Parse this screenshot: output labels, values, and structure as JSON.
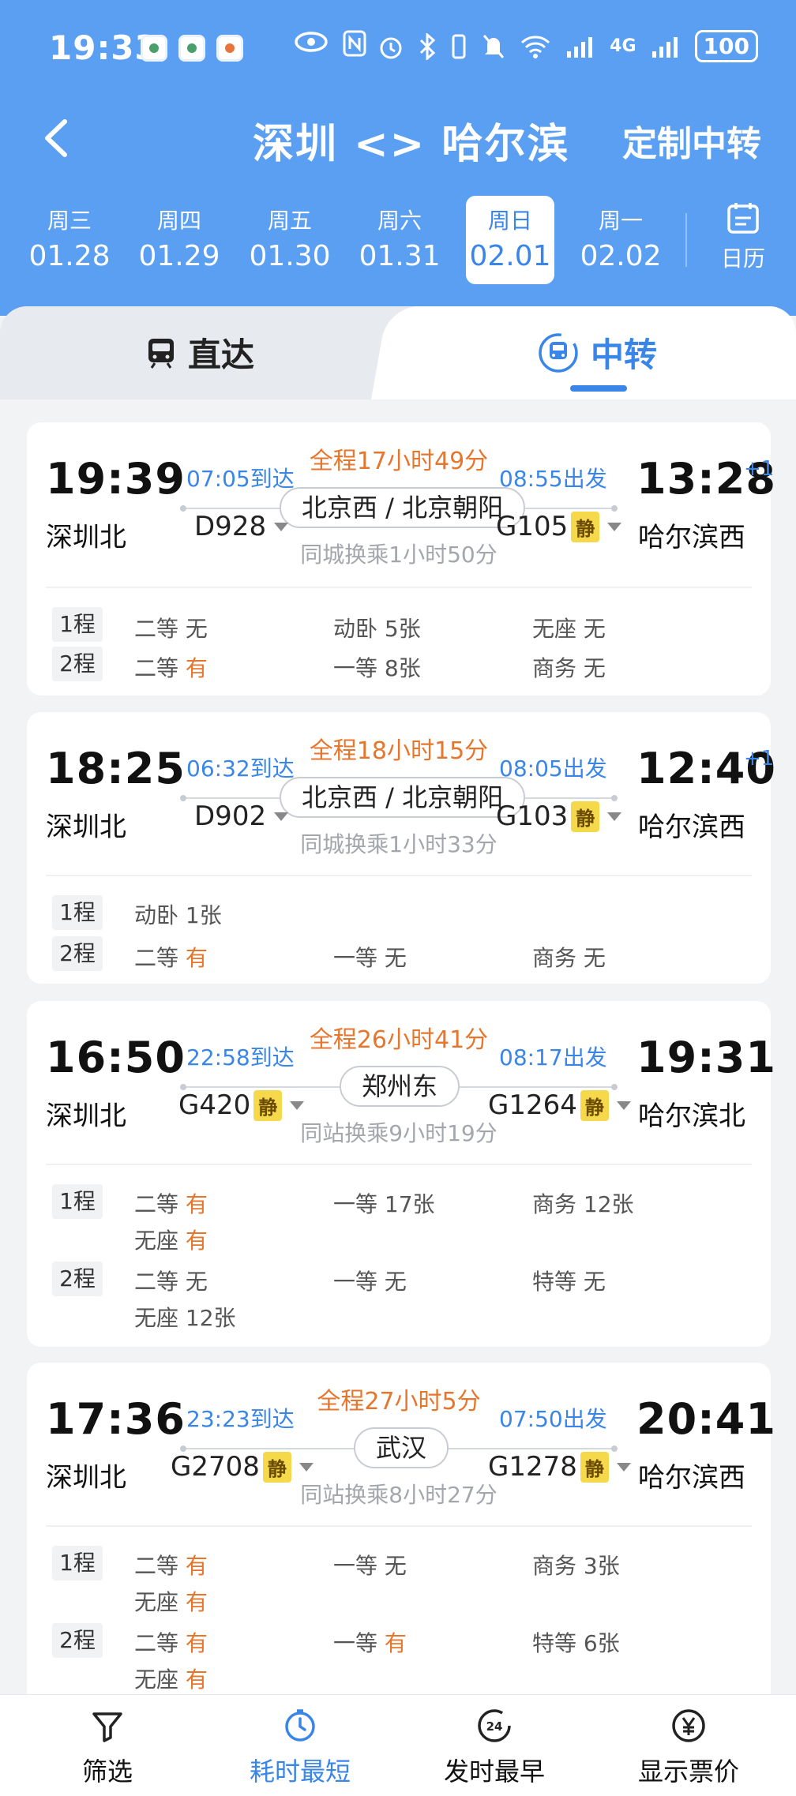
{
  "status_bar": {
    "time": "19:33",
    "battery": "100",
    "network": "4G"
  },
  "nav": {
    "title": "深圳 <> 哈尔滨",
    "action": "定制中转"
  },
  "dates": [
    {
      "dow": "周三",
      "date": "01.28"
    },
    {
      "dow": "周四",
      "date": "01.29"
    },
    {
      "dow": "周五",
      "date": "01.30"
    },
    {
      "dow": "周六",
      "date": "01.31"
    },
    {
      "dow": "周日",
      "date": "02.01"
    },
    {
      "dow": "周一",
      "date": "02.02"
    }
  ],
  "calendar_label": "日历",
  "tabs": {
    "direct": "直达",
    "transfer": "中转"
  },
  "cards": [
    {
      "dep_time": "19:39",
      "dep_station": "深圳北",
      "arr_time": "13:28",
      "arr_station": "哈尔滨西",
      "plus_day": "+1",
      "arrive_label": "07:05到达",
      "depart_label": "08:55出发",
      "total": "全程17小时49分",
      "hub": "北京西 / 北京朝阳",
      "train1": "D928",
      "train2": "G105",
      "note": "同城换乘1小时50分",
      "legs": [
        {
          "tag": "1程",
          "seats": [
            {
              "name": "二等",
              "val": "无"
            },
            {
              "name": "动卧",
              "val": "5张"
            },
            {
              "name": "无座",
              "val": "无"
            }
          ]
        },
        {
          "tag": "2程",
          "seats": [
            {
              "name": "二等",
              "val": "有"
            },
            {
              "name": "一等",
              "val": "8张"
            },
            {
              "name": "商务",
              "val": "无"
            }
          ]
        }
      ]
    },
    {
      "dep_time": "18:25",
      "dep_station": "深圳北",
      "arr_time": "12:40",
      "arr_station": "哈尔滨西",
      "plus_day": "+1",
      "arrive_label": "06:32到达",
      "depart_label": "08:05出发",
      "total": "全程18小时15分",
      "hub": "北京西 / 北京朝阳",
      "train1": "D902",
      "train2": "G103",
      "note": "同城换乘1小时33分",
      "legs": [
        {
          "tag": "1程",
          "seats": [
            {
              "name": "动卧",
              "val": "1张"
            }
          ]
        },
        {
          "tag": "2程",
          "seats": [
            {
              "name": "二等",
              "val": "有"
            },
            {
              "name": "一等",
              "val": "无"
            },
            {
              "name": "商务",
              "val": "无"
            }
          ]
        }
      ]
    },
    {
      "dep_time": "16:50",
      "dep_station": "深圳北",
      "arr_time": "19:31",
      "arr_station": "哈尔滨北",
      "plus_day": "",
      "arrive_label": "22:58到达",
      "depart_label": "08:17出发",
      "total": "全程26小时41分",
      "hub": "郑州东",
      "train1": "G420",
      "train2": "G1264",
      "note": "同站换乘9小时19分",
      "legs": [
        {
          "tag": "1程",
          "seats": [
            {
              "name": "二等",
              "val": "有"
            },
            {
              "name": "一等",
              "val": "17张"
            },
            {
              "name": "商务",
              "val": "12张"
            },
            {
              "name": "无座",
              "val": "有"
            }
          ]
        },
        {
          "tag": "2程",
          "seats": [
            {
              "name": "二等",
              "val": "无"
            },
            {
              "name": "一等",
              "val": "无"
            },
            {
              "name": "特等",
              "val": "无"
            },
            {
              "name": "无座",
              "val": "12张"
            }
          ]
        }
      ]
    },
    {
      "dep_time": "17:36",
      "dep_station": "深圳北",
      "arr_time": "20:41",
      "arr_station": "哈尔滨西",
      "plus_day": "",
      "arrive_label": "23:23到达",
      "depart_label": "07:50出发",
      "total": "全程27小时5分",
      "hub": "武汉",
      "train1": "G2708",
      "train2": "G1278",
      "note": "同站换乘8小时27分",
      "legs": [
        {
          "tag": "1程",
          "seats": [
            {
              "name": "二等",
              "val": "有"
            },
            {
              "name": "一等",
              "val": "无"
            },
            {
              "name": "商务",
              "val": "3张"
            },
            {
              "name": "无座",
              "val": "有"
            }
          ]
        },
        {
          "tag": "2程",
          "seats": [
            {
              "name": "二等",
              "val": "有"
            },
            {
              "name": "一等",
              "val": "有"
            },
            {
              "name": "特等",
              "val": "6张"
            },
            {
              "name": "无座",
              "val": "有"
            }
          ]
        }
      ]
    }
  ],
  "jing_label": "静",
  "bottom": [
    {
      "label": "筛选",
      "icon": "filter-icon"
    },
    {
      "label": "耗时最短",
      "icon": "clock-icon"
    },
    {
      "label": "发时最早",
      "icon": "24h-icon"
    },
    {
      "label": "显示票价",
      "icon": "yen-icon"
    }
  ],
  "colors": {
    "brand": "#5a9ff2",
    "accent": "#3a86e8",
    "highlight": "#e6762c",
    "jing": "#f6d94a"
  }
}
